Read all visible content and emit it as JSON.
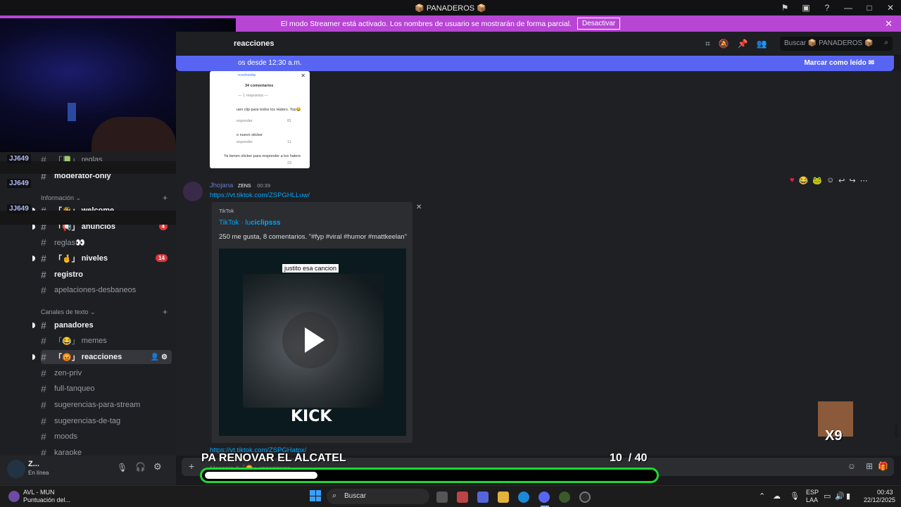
{
  "titlebar": {
    "title": "📦 PANADEROS 📦"
  },
  "banner": {
    "text": "El modo Streamer está activado. Los nombres de usuario se mostrarán de forma parcial.",
    "button": "Desactivar",
    "close": "✕"
  },
  "header": {
    "channel": "reacciones",
    "search_placeholder": "Buscar 📦 PANADEROS 📦"
  },
  "newbar": {
    "left": "os desde 12:30 a.m.",
    "right": "Marcar como leído"
  },
  "overlay_names": [
    "JJ649",
    "JJ649",
    "JJ649"
  ],
  "sidebar": {
    "channels": [
      {
        "name": "reglas",
        "prefix": "「📗」",
        "bold": false
      },
      {
        "name": "moderator-only",
        "prefix": "",
        "bold": true
      },
      {
        "name": "welcome",
        "prefix": "「👋」",
        "bold": true
      },
      {
        "name": "anuncios",
        "prefix": "「📢」",
        "bold": true,
        "badge": "4"
      },
      {
        "name": "reglas👀",
        "prefix": "",
        "bold": false
      },
      {
        "name": "niveles",
        "prefix": "「🤞」",
        "bold": true,
        "badge": "14"
      },
      {
        "name": "registro",
        "prefix": "",
        "bold": true
      },
      {
        "name": "apelaciones-desbaneos",
        "prefix": "",
        "bold": false
      },
      {
        "name": "panadores",
        "prefix": "",
        "bold": true
      },
      {
        "name": "memes",
        "prefix": "「😂」",
        "bold": false
      },
      {
        "name": "reacciones",
        "prefix": "「😡」",
        "bold": true
      },
      {
        "name": "zen-priv",
        "prefix": "",
        "bold": false
      },
      {
        "name": "full-tanqueo",
        "prefix": "",
        "bold": false
      },
      {
        "name": "sugerencias-para-stream",
        "prefix": "",
        "bold": false
      },
      {
        "name": "sugerencias-de-tag",
        "prefix": "",
        "bold": false
      },
      {
        "name": "moods",
        "prefix": "",
        "bold": false
      },
      {
        "name": "karaoke",
        "prefix": "",
        "bold": false
      }
    ],
    "category_info": "Información",
    "category_text": "Canales de texto"
  },
  "user": {
    "name": "Z...",
    "status": "En línea"
  },
  "chat": {
    "screenshot": {
      "user": "rcochovita",
      "count": "34 comentarios",
      "reply": "— 1 respuesta —",
      "line1": "uen clip para todos los Haters. Top😂",
      "resp1": "esponder",
      "line2": "o nuevo sticker",
      "line3": "Ya tienen sticker para responder a los haters",
      "resp2": "esponder",
      "n1": "81",
      "n2": "11",
      "n3": "23"
    },
    "message": {
      "author": "Jhojana",
      "tag": "ZENS",
      "time": "00:39",
      "link": "https://vt.tiktok.com/ZSPGHLLuw/",
      "link2": "https://vt.tiktok.com/ZSPGHatpx/"
    },
    "embed": {
      "provider": "TikTok",
      "title_a": "TikTok · lu",
      "title_b": "ciclipsss",
      "description": "250 me gusta, 8 comentarios. \"#fyp #viral #humor #mattkeelan\"",
      "caption": "justito esa cancion",
      "watermark": "KICK"
    },
    "input_placeholder": "Mensaje #「😡」reacciones"
  },
  "stream": {
    "title": "PA RENOVAR EL ALCATEL",
    "goal_current": "10",
    "goal_total": "/ 40",
    "progress": 0.25,
    "multiplier": "X9"
  },
  "taskbar": {
    "weather_title": "AVL - MUN",
    "weather_sub": "Puntuación del...",
    "search": "Buscar",
    "lang1": "ESP",
    "lang2": "LAA",
    "time": "00:43",
    "date": "22/12/2025"
  },
  "colors": {
    "banner": "#b845d4",
    "accent": "#5865f2",
    "progress": "#22d633"
  }
}
